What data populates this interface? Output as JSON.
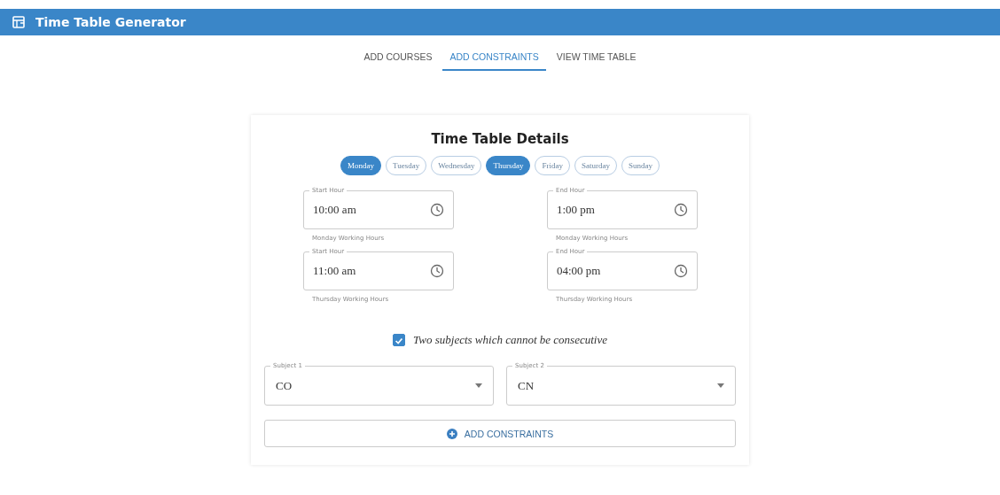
{
  "app_bar": {
    "title": "Time Table Generator"
  },
  "tabs": [
    {
      "label": "ADD COURSES",
      "selected": false
    },
    {
      "label": "ADD CONSTRAINTS",
      "selected": true
    },
    {
      "label": "VIEW TIME TABLE",
      "selected": false
    }
  ],
  "card": {
    "title": "Time Table Details",
    "days": [
      {
        "label": "Monday",
        "selected": true
      },
      {
        "label": "Tuesday",
        "selected": false
      },
      {
        "label": "Wednesday",
        "selected": false
      },
      {
        "label": "Thursday",
        "selected": true
      },
      {
        "label": "Friday",
        "selected": false
      },
      {
        "label": "Saturday",
        "selected": false
      },
      {
        "label": "Sunday",
        "selected": false
      }
    ],
    "hours": [
      {
        "start": {
          "label": "Start Hour",
          "value": "10:00 am",
          "helper": "Monday Working Hours"
        },
        "end": {
          "label": "End Hour",
          "value": "1:00 pm",
          "helper": "Monday Working Hours"
        }
      },
      {
        "start": {
          "label": "Start Hour",
          "value": "11:00 am",
          "helper": "Thursday Working Hours"
        },
        "end": {
          "label": "End Hour",
          "value": "04:00 pm",
          "helper": "Thursday Working Hours"
        }
      }
    ],
    "constraint": {
      "label": "Two subjects which cannot be consecutive",
      "checked": true
    },
    "subjects": [
      {
        "label": "Subject 1",
        "value": "CO"
      },
      {
        "label": "Subject 2",
        "value": "CN"
      }
    ],
    "button": "ADD CONSTRAINTS"
  }
}
